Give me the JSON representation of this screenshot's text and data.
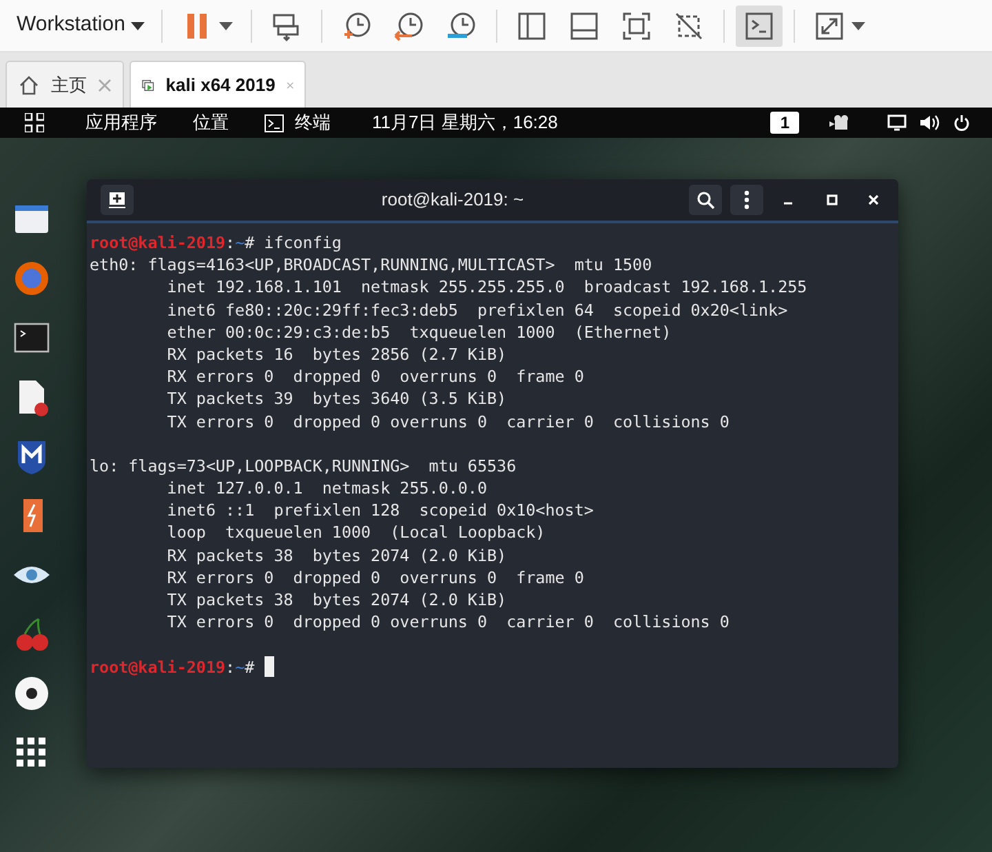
{
  "toolbar": {
    "menu_label": "Workstation",
    "icons": [
      {
        "kind": "pause",
        "on": false
      },
      {
        "kind": "send-keys",
        "on": false
      },
      {
        "kind": "snapshot",
        "on": false
      },
      {
        "kind": "revert",
        "on": false
      },
      {
        "kind": "manage",
        "on": false
      },
      {
        "kind": "library",
        "on": false
      },
      {
        "kind": "thumbnail",
        "on": false
      },
      {
        "kind": "fullscreen",
        "on": false
      },
      {
        "kind": "unity",
        "on": false
      },
      {
        "kind": "console",
        "on": true
      },
      {
        "kind": "stretch",
        "on": false
      }
    ]
  },
  "tabs": [
    {
      "label": "主页",
      "kind": "home",
      "selected": false
    },
    {
      "label": "kali x64 2019",
      "kind": "vm",
      "selected": true
    }
  ],
  "top_bar": {
    "menus": [
      "应用程序",
      "位置",
      "终端"
    ],
    "clock": "11月7日 星期六，16:28",
    "workspace": "1"
  },
  "dock": [
    {
      "kind": "files"
    },
    {
      "kind": "browser"
    },
    {
      "kind": "terminal"
    },
    {
      "kind": "editor"
    },
    {
      "kind": "shield"
    },
    {
      "kind": "burp"
    },
    {
      "kind": "eye"
    },
    {
      "kind": "cherry"
    },
    {
      "kind": "disc"
    },
    {
      "kind": "apps"
    }
  ],
  "terminal": {
    "title": "root@kali-2019: ~",
    "lines": [
      {
        "kind": "prompt",
        "user": "root@kali-2019",
        "separator": ":",
        "path": "~",
        "symbol": "#",
        "command": "ifconfig"
      },
      {
        "kind": "output",
        "text": "eth0: flags=4163<UP,BROADCAST,RUNNING,MULTICAST>  mtu 1500"
      },
      {
        "kind": "output",
        "text": "        inet 192.168.1.101  netmask 255.255.255.0  broadcast 192.168.1.255"
      },
      {
        "kind": "output",
        "text": "        inet6 fe80::20c:29ff:fec3:deb5  prefixlen 64  scopeid 0x20<link>"
      },
      {
        "kind": "output",
        "text": "        ether 00:0c:29:c3:de:b5  txqueuelen 1000  (Ethernet)"
      },
      {
        "kind": "output",
        "text": "        RX packets 16  bytes 2856 (2.7 KiB)"
      },
      {
        "kind": "output",
        "text": "        RX errors 0  dropped 0  overruns 0  frame 0"
      },
      {
        "kind": "output",
        "text": "        TX packets 39  bytes 3640 (3.5 KiB)"
      },
      {
        "kind": "output",
        "text": "        TX errors 0  dropped 0 overruns 0  carrier 0  collisions 0"
      },
      {
        "kind": "blank"
      },
      {
        "kind": "output",
        "text": "lo: flags=73<UP,LOOPBACK,RUNNING>  mtu 65536"
      },
      {
        "kind": "output",
        "text": "        inet 127.0.0.1  netmask 255.0.0.0"
      },
      {
        "kind": "output",
        "text": "        inet6 ::1  prefixlen 128  scopeid 0x10<host>"
      },
      {
        "kind": "output",
        "text": "        loop  txqueuelen 1000  (Local Loopback)"
      },
      {
        "kind": "output",
        "text": "        RX packets 38  bytes 2074 (2.0 KiB)"
      },
      {
        "kind": "output",
        "text": "        RX errors 0  dropped 0  overruns 0  frame 0"
      },
      {
        "kind": "output",
        "text": "        TX packets 38  bytes 2074 (2.0 KiB)"
      },
      {
        "kind": "output",
        "text": "        TX errors 0  dropped 0 overruns 0  carrier 0  collisions 0"
      },
      {
        "kind": "blank"
      },
      {
        "kind": "prompt",
        "user": "root@kali-2019",
        "separator": ":",
        "path": "~",
        "symbol": "#",
        "cursor": true
      }
    ]
  }
}
